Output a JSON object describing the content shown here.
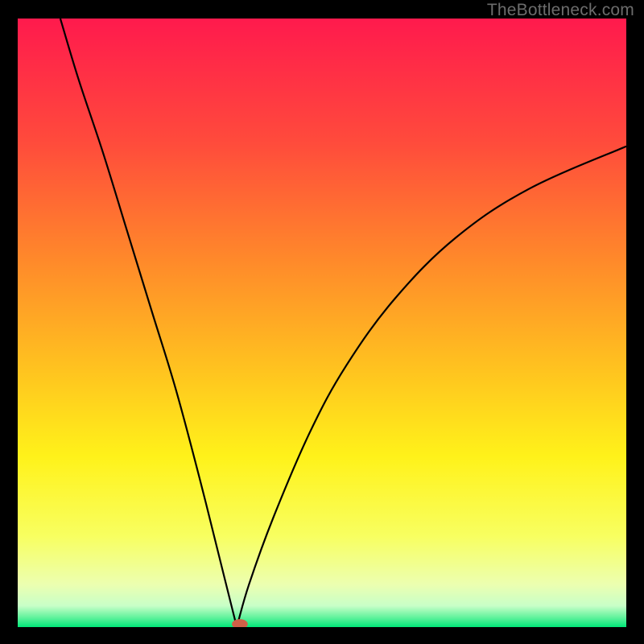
{
  "watermark": "TheBottleneck.com",
  "chart_data": {
    "type": "line",
    "title": "",
    "xlabel": "",
    "ylabel": "",
    "xlim": [
      0,
      100
    ],
    "ylim": [
      0,
      100
    ],
    "gradient_stops": [
      {
        "offset": 0,
        "color": "#ff1a4d"
      },
      {
        "offset": 0.2,
        "color": "#ff4a3c"
      },
      {
        "offset": 0.4,
        "color": "#ff8a2a"
      },
      {
        "offset": 0.58,
        "color": "#ffc41f"
      },
      {
        "offset": 0.72,
        "color": "#fff21a"
      },
      {
        "offset": 0.85,
        "color": "#f8ff60"
      },
      {
        "offset": 0.93,
        "color": "#ecffb0"
      },
      {
        "offset": 0.965,
        "color": "#c8ffc8"
      },
      {
        "offset": 0.985,
        "color": "#5cf29a"
      },
      {
        "offset": 1.0,
        "color": "#00e878"
      }
    ],
    "curve": {
      "min_x": 36,
      "left": [
        {
          "x": 7,
          "y": 100
        },
        {
          "x": 10,
          "y": 90
        },
        {
          "x": 14,
          "y": 78
        },
        {
          "x": 18,
          "y": 65
        },
        {
          "x": 22,
          "y": 52
        },
        {
          "x": 26,
          "y": 39
        },
        {
          "x": 30,
          "y": 24
        },
        {
          "x": 34,
          "y": 8
        },
        {
          "x": 36,
          "y": 0
        }
      ],
      "right": [
        {
          "x": 36,
          "y": 0
        },
        {
          "x": 38,
          "y": 7
        },
        {
          "x": 42,
          "y": 18
        },
        {
          "x": 48,
          "y": 32
        },
        {
          "x": 54,
          "y": 43
        },
        {
          "x": 62,
          "y": 54
        },
        {
          "x": 72,
          "y": 64
        },
        {
          "x": 84,
          "y": 72
        },
        {
          "x": 100,
          "y": 79
        }
      ]
    },
    "marker": {
      "x": 36.5,
      "y": 0.5,
      "rx": 1.3,
      "ry": 0.8,
      "color": "#d06048"
    }
  }
}
